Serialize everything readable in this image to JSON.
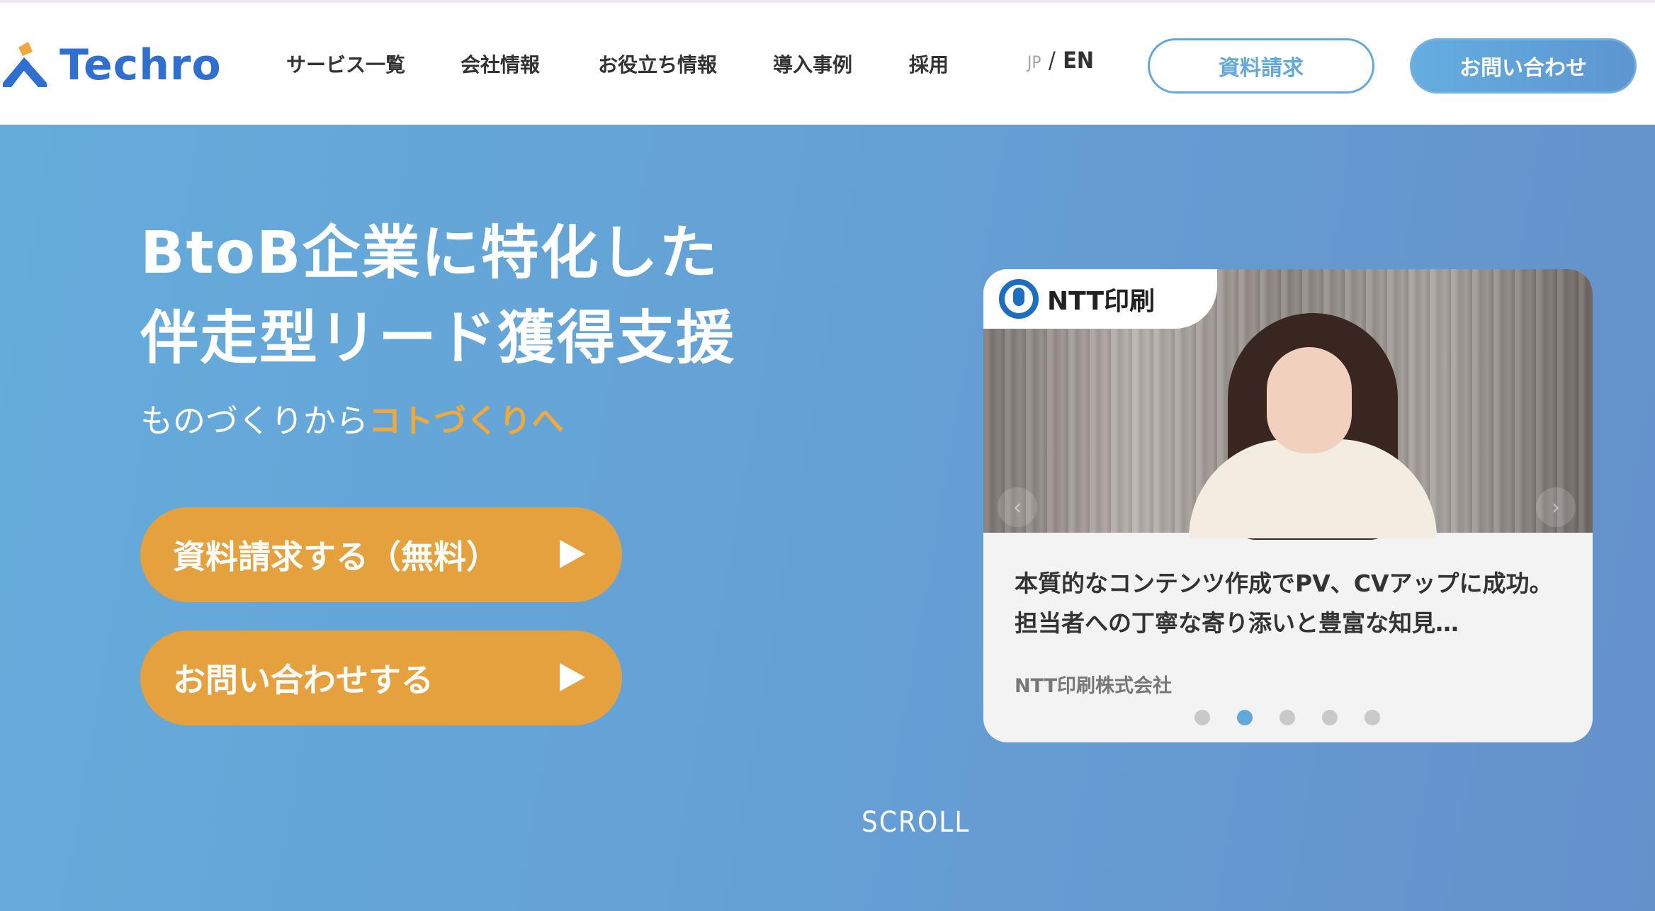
{
  "header": {
    "logo_text": "Techro",
    "nav": [
      "サービス一覧",
      "会社情報",
      "お役立ち情報",
      "導入事例",
      "採用"
    ],
    "lang_jp": "JP",
    "lang_sep": "/",
    "lang_en": "EN",
    "doc_button": "資料請求",
    "contact_button": "お問い合わせ"
  },
  "colors": {
    "brand": "#2f6fd0",
    "logo_orange": "#f2a93b",
    "hero_bg": "#659fd4",
    "cta": "#e5a13d",
    "accent_blue": "#64a7d9"
  },
  "hero": {
    "line1": "BtoB企業に特化した",
    "line2": "伴走型リード獲得支援",
    "sub_plain": "ものづくりから",
    "sub_highlight": "コトづくりへ",
    "cta_doc": "資料請求する（無料）",
    "cta_contact": "お問い合わせする",
    "scroll": "SCROLL"
  },
  "case_card": {
    "tag": "NTT印刷",
    "text": "本質的なコンテンツ作成でPV、CVアップに成功。担当者への丁寧な寄り添いと豊富な知見…",
    "company": "NTT印刷株式会社",
    "dots": 5,
    "active_dot": 2,
    "prev_icon": "chevron-left-icon",
    "next_icon": "chevron-right-icon"
  }
}
